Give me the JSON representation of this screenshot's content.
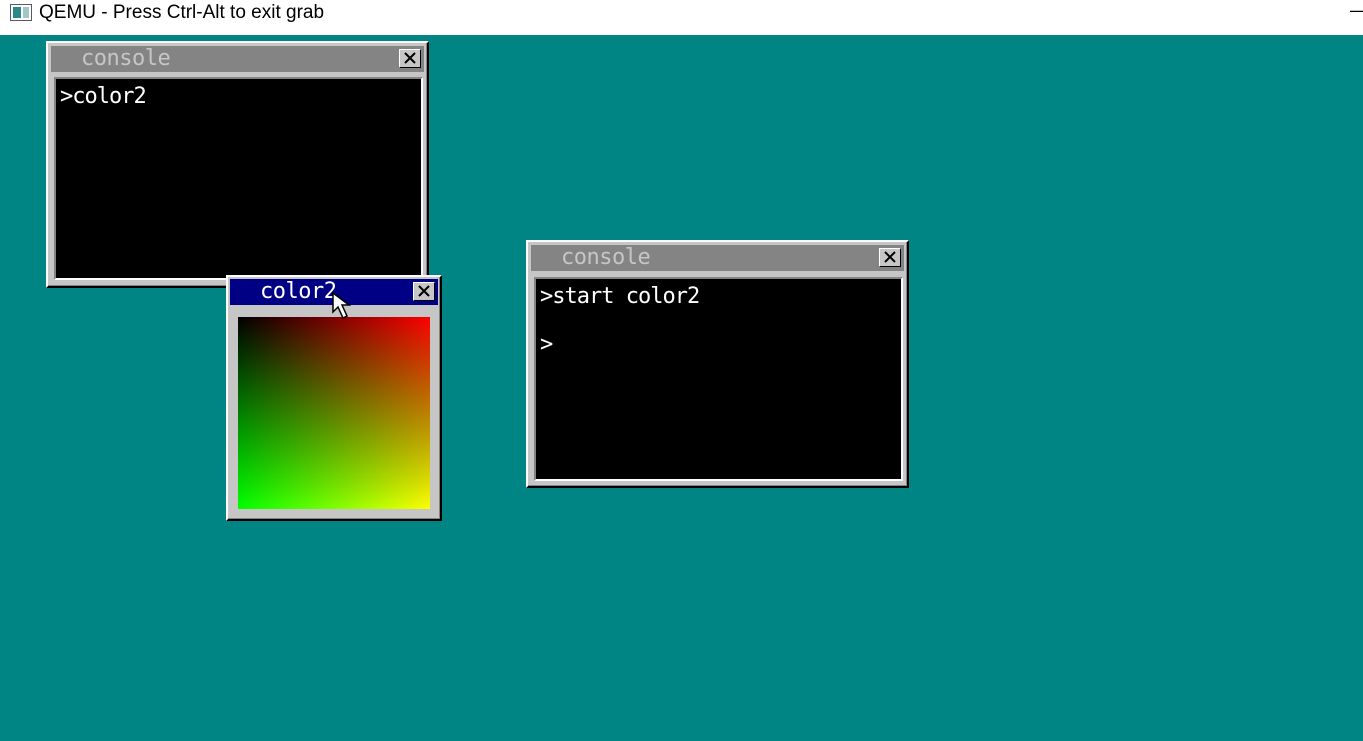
{
  "host_window": {
    "title": "QEMU - Press Ctrl-Alt to exit grab",
    "minimize_label": "—"
  },
  "desktop": {
    "background_color": "#008484"
  },
  "windows": {
    "console1": {
      "title": "console",
      "lines": [
        ">color2"
      ]
    },
    "color2": {
      "title": "color2",
      "gradient": {
        "top_left": "#000000",
        "top_right": "#ff0000",
        "bottom_left": "#00ff00",
        "bottom_right": "#ffff00"
      }
    },
    "console2": {
      "title": "console",
      "lines": [
        ">start color2",
        ">"
      ]
    }
  },
  "icons": {
    "close": "close-icon",
    "cursor": "mouse-pointer-icon",
    "app": "qemu-app-icon"
  }
}
